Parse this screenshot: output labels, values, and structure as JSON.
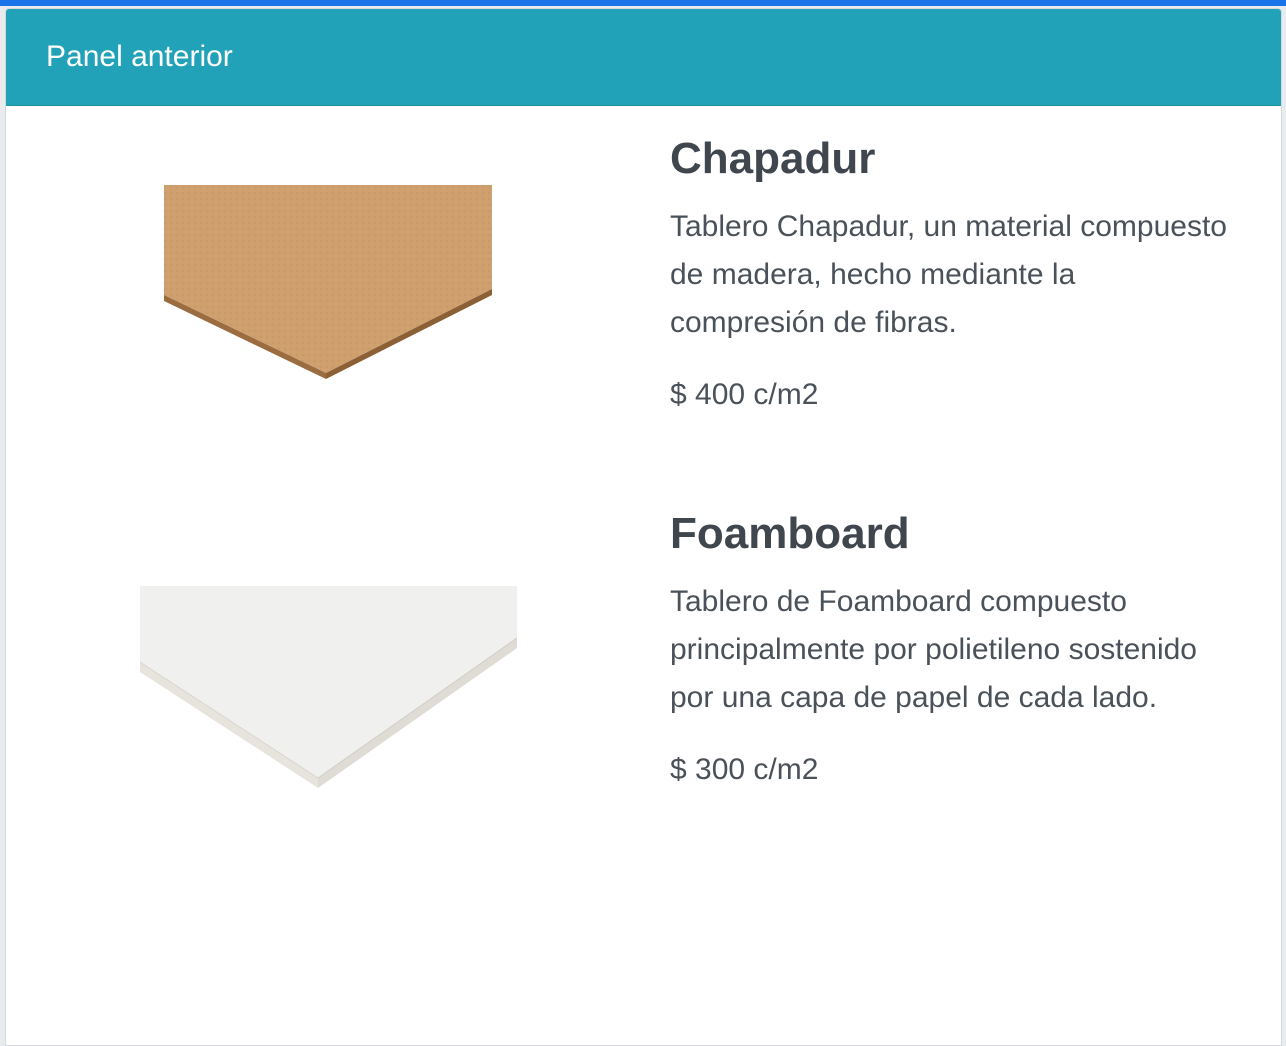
{
  "panel": {
    "title": "Panel anterior"
  },
  "products": [
    {
      "name": "Chapadur",
      "description": "Tablero Chapadur, un material compuesto de madera, hecho mediante la compresión de fibras.",
      "price": "$ 400 c/m2",
      "image_icon": "hardboard-sheet-image",
      "colors": {
        "top": "#c99a68",
        "edge": "#a27446"
      }
    },
    {
      "name": "Foamboard",
      "description": "Tablero de Foamboard compuesto principalmente por polietileno sostenido por una capa de papel de cada lado.",
      "price": "$ 300 c/m2",
      "image_icon": "foamboard-sheet-image",
      "colors": {
        "top": "#f2f2f2",
        "edge": "#e4e2da"
      }
    }
  ],
  "colors": {
    "header_bg": "#22a2b8",
    "accent_bar": "#1a73e8",
    "text": "#444b53"
  }
}
